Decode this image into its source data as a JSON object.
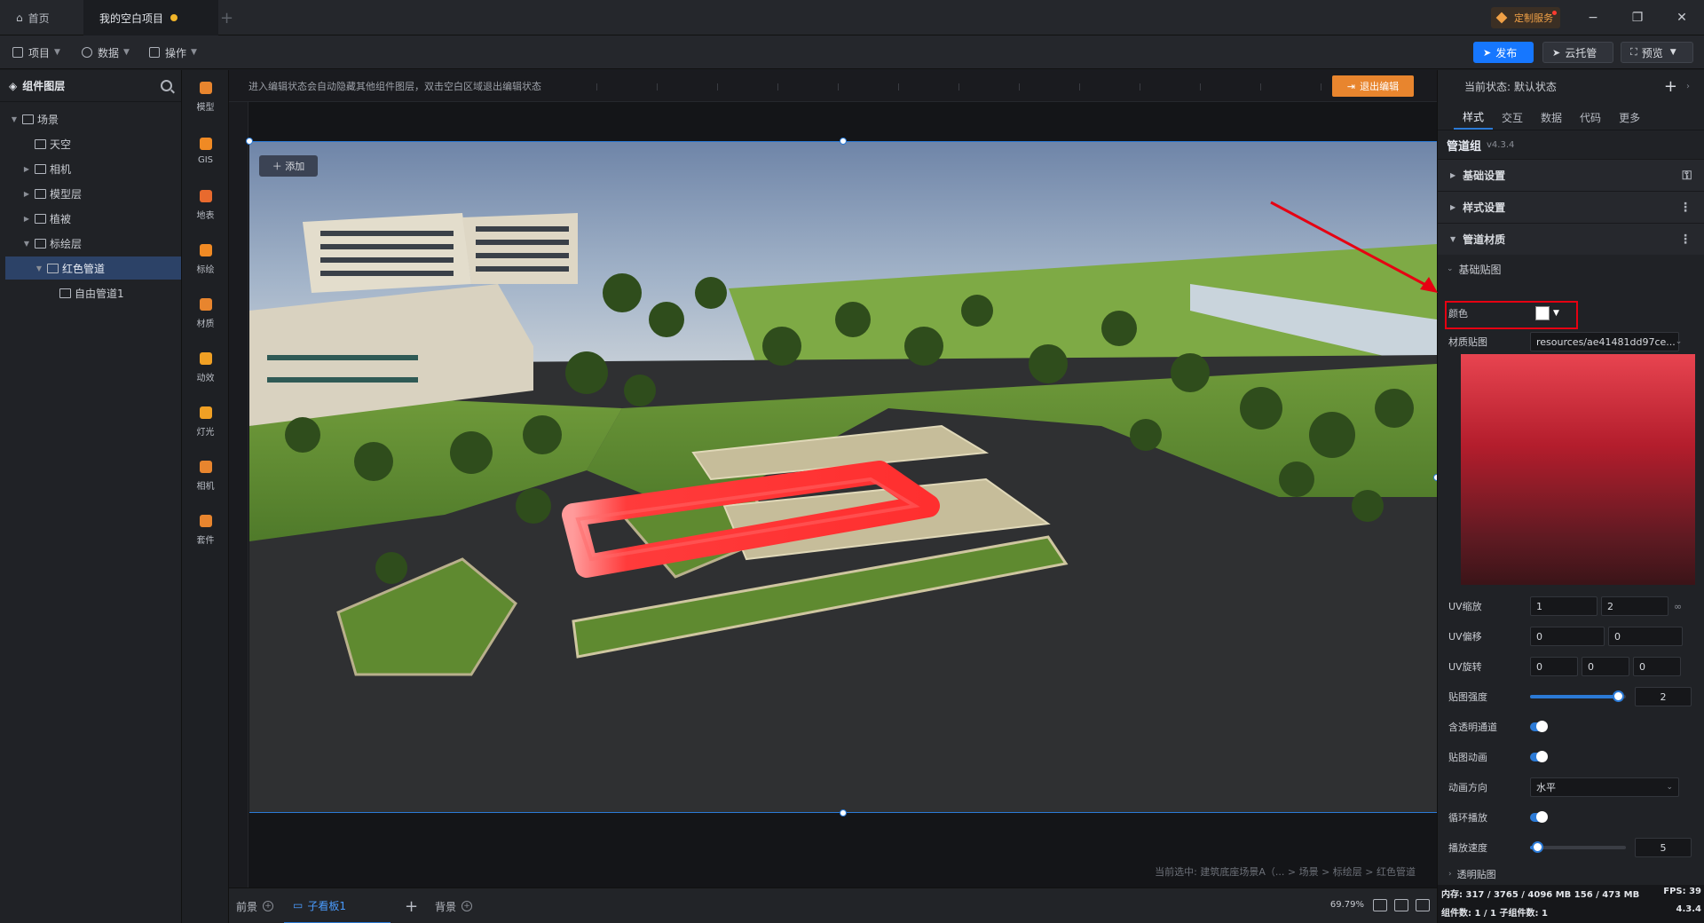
{
  "titlebar": {
    "home_tab": "首页",
    "project_tab": "我的空白项目",
    "custom_service": "定制服务",
    "minimize": "−",
    "restore": "❐",
    "close": "✕"
  },
  "toolbar": {
    "menus": [
      "项目",
      "数据",
      "操作"
    ],
    "publish": "发布",
    "cloud_hosting": "云托管",
    "preview": "预览"
  },
  "layers": {
    "title": "组件图层",
    "items": [
      {
        "label": "场景",
        "depth": 0,
        "expanded": true
      },
      {
        "label": "天空",
        "depth": 1
      },
      {
        "label": "相机",
        "depth": 1
      },
      {
        "label": "模型层",
        "depth": 1
      },
      {
        "label": "植被",
        "depth": 1
      },
      {
        "label": "标绘层",
        "depth": 1,
        "expanded": true
      },
      {
        "label": "红色管道",
        "depth": 2,
        "expanded": true,
        "selected": true
      },
      {
        "label": "自由管道1",
        "depth": 3
      }
    ]
  },
  "rail": {
    "items": [
      "模型",
      "GIS",
      "地表",
      "标绘",
      "材质",
      "动效",
      "灯光",
      "相机",
      "套件"
    ]
  },
  "canvas": {
    "hint": "进入编辑状态会自动隐藏其他组件图层，双击空白区域退出编辑状态",
    "exit_button": "退出编辑",
    "add_button": "＋ 添加",
    "breadcrumb": "当前选中: 建筑底座场景A（... > 场景 > 标绘层 > 红色管道"
  },
  "bottombar": {
    "tabs": [
      "前景",
      "子看板1",
      "背景"
    ],
    "zoom": "69.79%"
  },
  "properties": {
    "state_label": "当前状态:  默认状态",
    "tabs": [
      "样式",
      "交互",
      "数据",
      "代码",
      "更多"
    ],
    "component_title": "管道组",
    "version": "v4.3.4",
    "sections": [
      "基础设置",
      "样式设置",
      "管道材质"
    ],
    "subsection": "基础贴图",
    "color_label": "颜色",
    "color_value": "#ffffff",
    "texture_label": "材质贴图",
    "texture_value": "resources/ae41481dd97ce...",
    "uv_scale_label": "UV缩放",
    "uv_scale": [
      "1",
      "2"
    ],
    "uv_offset_label": "UV偏移",
    "uv_offset": [
      "0",
      "0"
    ],
    "uv_rotate_label": "UV旋转",
    "uv_rotate": [
      "0",
      "0",
      "0"
    ],
    "intensity_label": "贴图强度",
    "intensity": "2",
    "intensity_fraction": 0.92,
    "alpha_label": "含透明通道",
    "animate_label": "贴图动画",
    "direction_label": "动画方向",
    "direction_value": "水平",
    "loop_label": "循环播放",
    "speed_label": "播放速度",
    "speed": "5",
    "speed_fraction": 0.04,
    "next_section": "透明贴图"
  },
  "status": {
    "memory": "内存: 317 / 3765 / 4096 MB  156 / 473 MB",
    "fps": "FPS: 39",
    "counts": "组件数: 1 / 1   子组件数: 1",
    "version": "4.3.4"
  },
  "colors": {
    "accent": "#1677ff",
    "pipe": "#ff3b3b",
    "highlight": "#e60012",
    "exit": "#e8852e"
  }
}
